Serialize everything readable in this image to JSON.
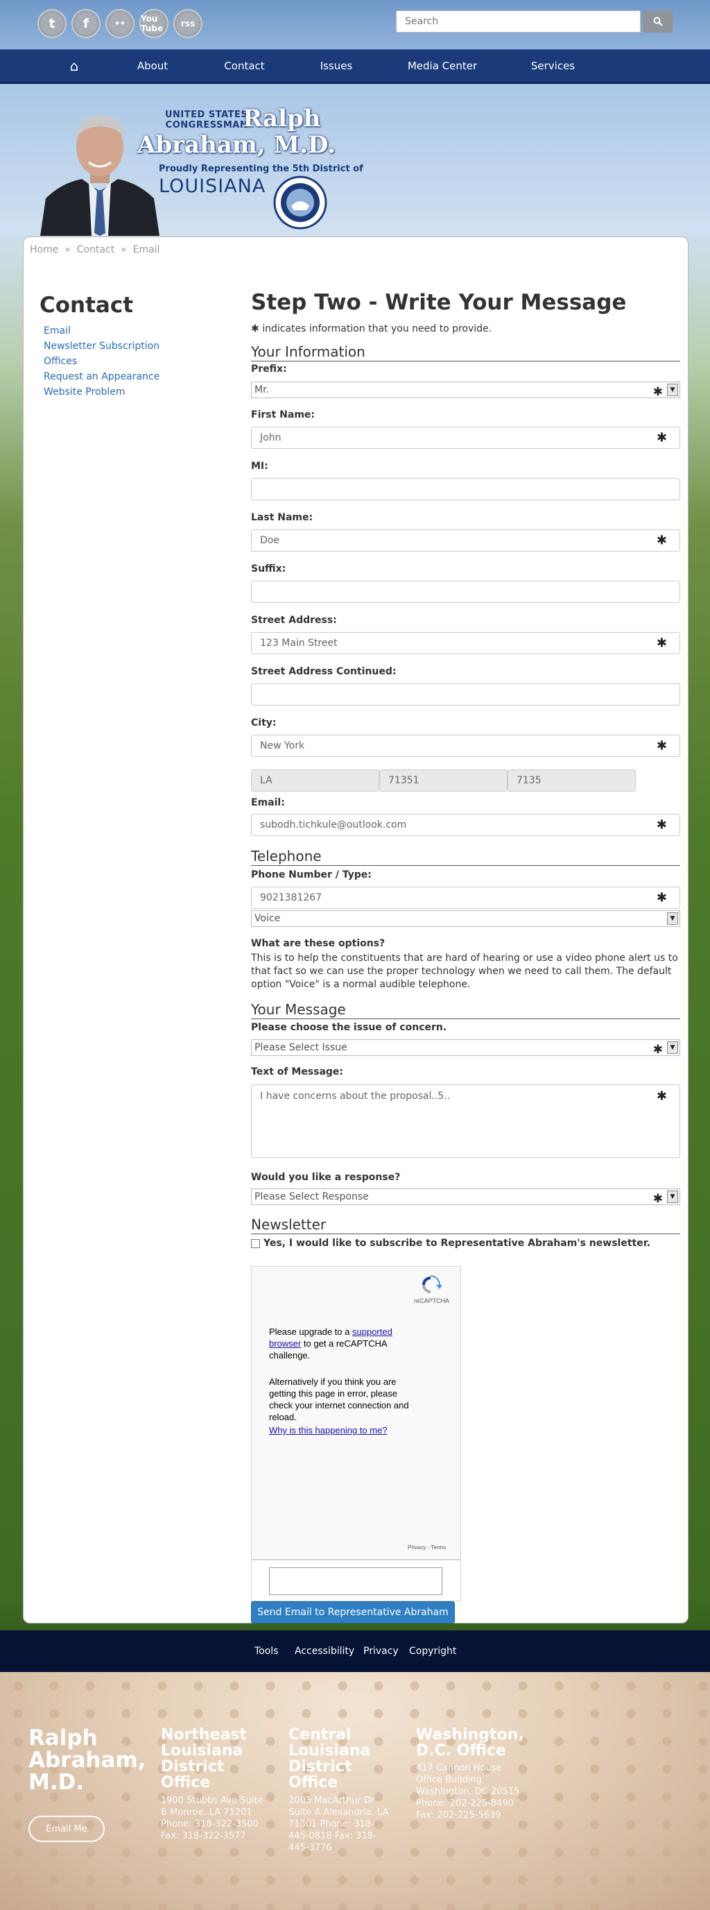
{
  "search": {
    "placeholder": "Search"
  },
  "social": {
    "twitter": "t",
    "facebook": "f",
    "flickr": "••",
    "youtube": "You Tube",
    "rss": "rss"
  },
  "nav": {
    "home": "⌂",
    "about": "About",
    "contact": "Contact",
    "issues": "Issues",
    "media": "Media Center",
    "services": "Services"
  },
  "banner": {
    "line1": "UNITED STATES",
    "line2": "CONGRESSMAN",
    "first": "Ralph",
    "last": "Abraham, M.D.",
    "sub": "Proudly Representing the 5th District of",
    "state": "LOUISIANA"
  },
  "breadcrumb": {
    "home": "Home",
    "contact": "Contact",
    "email": "Email",
    "sep": "»"
  },
  "sidebar": {
    "title": "Contact",
    "links": [
      "Email",
      "Newsletter Subscription",
      "Offices",
      "Request an Appearance",
      "Website Problem"
    ]
  },
  "form": {
    "title": "Step Two - Write Your Message",
    "required_note": "indicates information that you need to provide.",
    "required_mark": "✱",
    "section_info": "Your Information",
    "prefix_label": "Prefix:",
    "prefix_value": "Mr.",
    "first_label": "First Name:",
    "first_value": "John",
    "mi_label": "MI:",
    "last_label": "Last Name:",
    "last_value": "Doe",
    "suffix_label": "Suffix:",
    "street_label": "Street Address:",
    "street_value": "123 Main Street",
    "street2_label": "Street Address Continued:",
    "city_label": "City:",
    "city_value": "New York",
    "state_value": "LA",
    "zip_value": "71351",
    "zip4_value": "7135",
    "email_label": "Email:",
    "email_value": "subodh.tichkule@outlook.com",
    "section_phone": "Telephone",
    "phone_label": "Phone Number / Type:",
    "phone_value": "9021381267",
    "phone_type": "Voice",
    "options_title": "What are these options?",
    "options_text": "This is to help the constituents that are hard of hearing or use a video phone alert us to that fact so we can use the proper technology when we need to call them. The default option \"Voice\" is a normal audible telephone.",
    "section_message": "Your Message",
    "issue_label": "Please choose the issue of concern.",
    "issue_value": "Please Select Issue",
    "text_label": "Text of Message:",
    "text_value": "I have concerns about the proposal..5..",
    "response_label": "Would you like a response?",
    "response_value": "Please Select Response",
    "section_newsletter": "Newsletter",
    "newsletter_check": "Yes, I would like to subscribe to Representative Abraham's newsletter.",
    "submit": "Send Email to Representative Abraham"
  },
  "captcha": {
    "brand": "reCAPTCHA",
    "p1_a": "Please upgrade to a",
    "p1_link": "supported browser",
    "p1_b": "to get a reCAPTCHA challenge.",
    "p2": "Alternatively if you think you are getting this page in error, please check your internet connection and reload.",
    "why": "Why is this happening to me?",
    "privacy": "Privacy - Terms"
  },
  "footer": {
    "links": [
      "Tools",
      "Accessibility",
      "Privacy",
      "Copyright"
    ],
    "name": "Ralph Abraham, M.D.",
    "email_me": "Email Me",
    "col1_title": "Northeast Louisiana District Office",
    "col1_text": "1900 Stubbs Ave Suite B Monroe, LA 71201 Phone: 318-322-3500 Fax: 318-322-3577",
    "col2_title": "Central Louisiana District Office",
    "col2_text": "2003 MacArthur Dr Suite A Alexandria, LA 71301 Phone: 318-445-0818 Fax: 318-445-3776",
    "col3_title": "Washington, D.C. Office",
    "col3_text": "417 Cannon House Office Building Washington, DC 20515 Phone: 202-225-8490 Fax: 202-225-5639"
  },
  "colors": {
    "nav": "#1a3a7a",
    "link": "#2a6bb5",
    "button": "#2f7fc4",
    "footbar": "#071334"
  }
}
